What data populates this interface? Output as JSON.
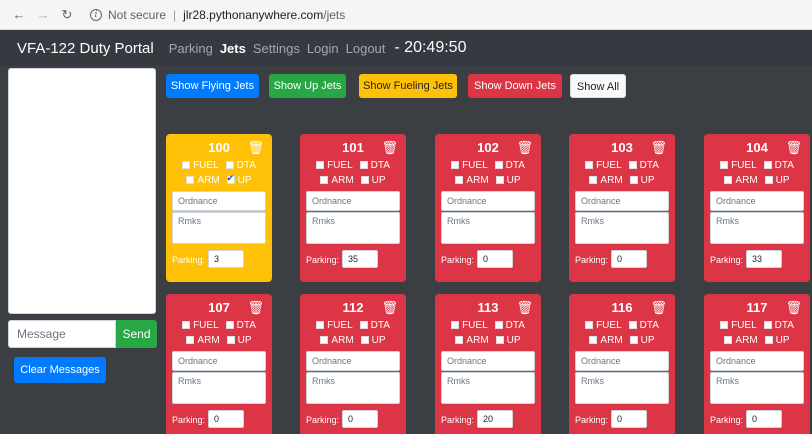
{
  "browser": {
    "security": "Not secure",
    "url_host": "jlr28.pythonanywhere.com",
    "url_path": "/jets"
  },
  "navbar": {
    "brand": "VFA-122 Duty Portal",
    "links": [
      "Parking",
      "Jets",
      "Settings",
      "Login",
      "Logout"
    ],
    "active": "Jets",
    "time": "- 20:49:50"
  },
  "messages": {
    "placeholder": "Message",
    "send_label": "Send",
    "clear_label": "Clear Messages"
  },
  "filters": {
    "flying": "Show Flying Jets",
    "up": "Show Up Jets",
    "fueling": "Show Fueling Jets",
    "down": "Show Down Jets",
    "all": "Show All"
  },
  "colors": {
    "down": "#dc3545",
    "fueling": "#ffc107",
    "up": "#28a745",
    "flying": "#007bff"
  },
  "labels": {
    "fuel": "FUEL",
    "dta": "DTA",
    "arm": "ARM",
    "up": "UP",
    "ordnance": "Ordnance",
    "rmks": "Rmks",
    "parking": "Parking:"
  },
  "jets": [
    {
      "number": "100",
      "status": "fueling",
      "fuel": false,
      "dta": false,
      "arm": false,
      "up": true,
      "parking": "3"
    },
    {
      "number": "101",
      "status": "down",
      "fuel": false,
      "dta": false,
      "arm": false,
      "up": false,
      "parking": "35"
    },
    {
      "number": "102",
      "status": "down",
      "fuel": false,
      "dta": false,
      "arm": false,
      "up": false,
      "parking": "0"
    },
    {
      "number": "103",
      "status": "down",
      "fuel": false,
      "dta": false,
      "arm": false,
      "up": false,
      "parking": "0"
    },
    {
      "number": "104",
      "status": "down",
      "fuel": false,
      "dta": false,
      "arm": false,
      "up": false,
      "parking": "33"
    },
    {
      "number": "107",
      "status": "down",
      "fuel": false,
      "dta": false,
      "arm": false,
      "up": false,
      "parking": "0"
    },
    {
      "number": "112",
      "status": "down",
      "fuel": false,
      "dta": false,
      "arm": false,
      "up": false,
      "parking": "0"
    },
    {
      "number": "113",
      "status": "down",
      "fuel": false,
      "dta": false,
      "arm": false,
      "up": false,
      "parking": "20"
    },
    {
      "number": "116",
      "status": "down",
      "fuel": false,
      "dta": false,
      "arm": false,
      "up": false,
      "parking": "0"
    },
    {
      "number": "117",
      "status": "down",
      "fuel": false,
      "dta": false,
      "arm": false,
      "up": false,
      "parking": "0"
    }
  ]
}
